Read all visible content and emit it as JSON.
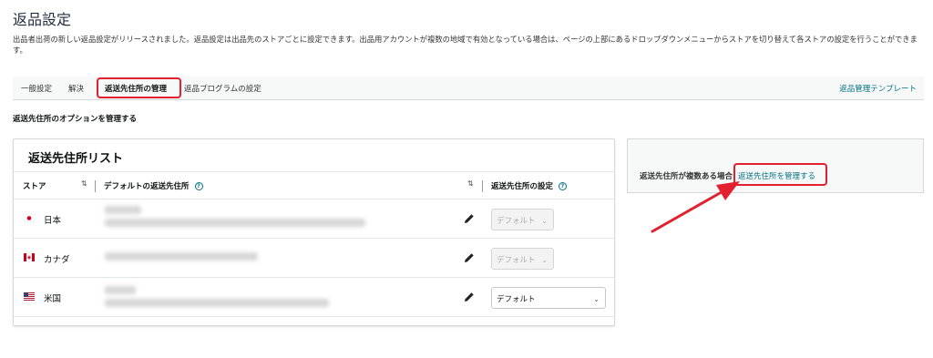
{
  "page": {
    "title": "返品設定",
    "intro": "出品者出荷の新しい返品設定がリリースされました。返品設定は出品先のストアごとに設定できます。出品用アカウントが複数の地域で有効となっている場合は、ページの上部にあるドロップダウンメニューからストアを切り替えて各ストアの設定を行うことができます。"
  },
  "tabs": [
    {
      "label": "一般設定"
    },
    {
      "label": "解決"
    },
    {
      "label": "返送先住所の管理"
    },
    {
      "label": "返品プログラムの設定"
    }
  ],
  "tab_link": "返品管理テンプレート",
  "section_label": "返送先住所のオプションを管理する",
  "card": {
    "title": "返送先住所リスト",
    "columns": {
      "store": "ストア",
      "default_address": "デフォルトの返送先住所",
      "setting": "返送先住所の設定"
    },
    "rows": [
      {
        "store": "日本",
        "setting": "デフォルト",
        "enabled": false
      },
      {
        "store": "カナダ",
        "setting": "デフォルト",
        "enabled": false
      },
      {
        "store": "米国",
        "setting": "デフォルト",
        "enabled": true
      }
    ]
  },
  "side": {
    "text": "返送先住所が複数ある場合",
    "link": "返送先住所を管理する"
  },
  "icons": {
    "sort": "sort-arrows-icon",
    "help": "help-circle-icon",
    "edit": "pencil-icon",
    "dropdown": "chevron-down-icon"
  },
  "colors": {
    "link": "#007185",
    "highlight": "#e3202f",
    "text": "#0f1111"
  }
}
